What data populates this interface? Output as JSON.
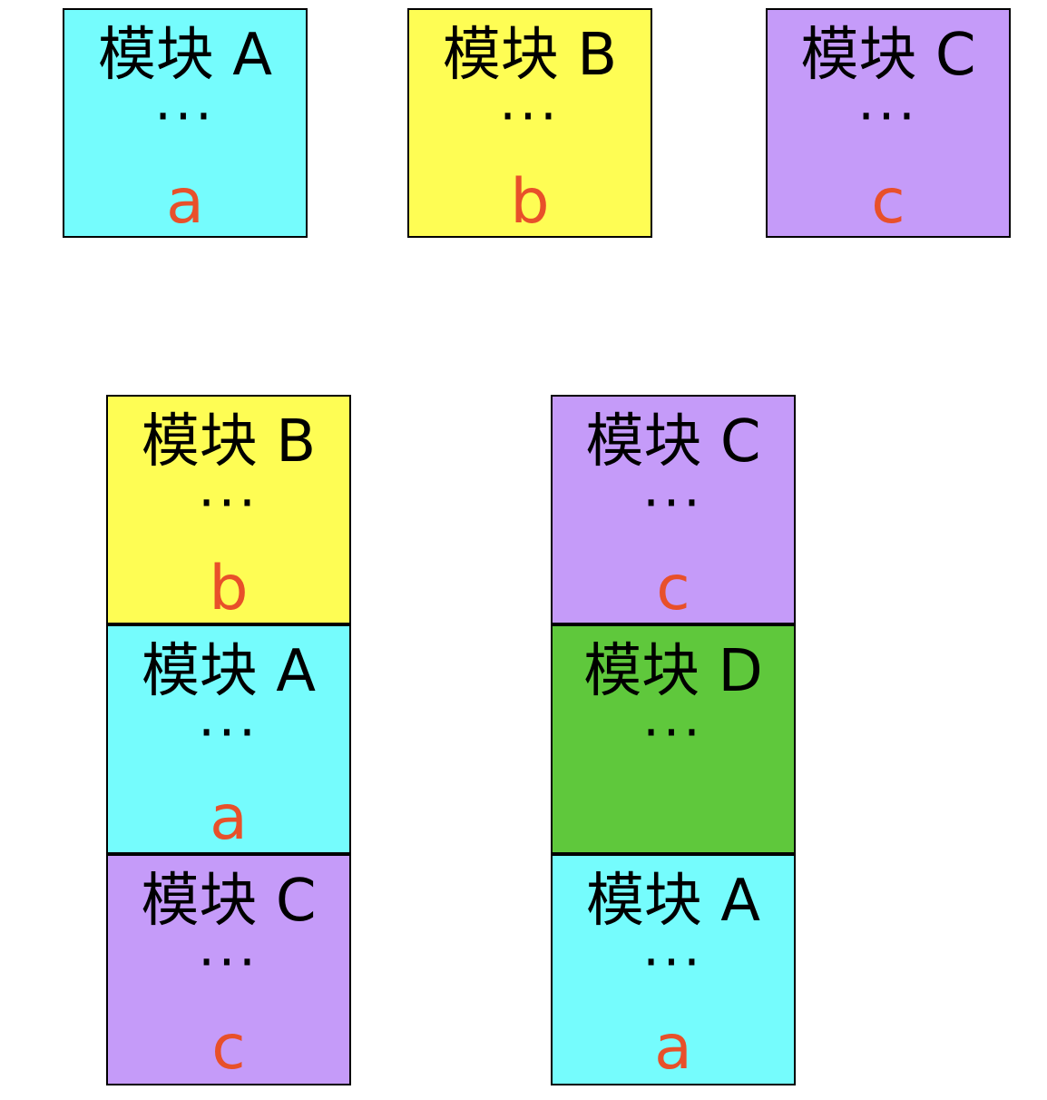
{
  "colors": {
    "A": "#75fcfd",
    "B": "#fefd54",
    "C": "#c59bf9",
    "D": "#5fc83c",
    "var_text": "#e8502a"
  },
  "top_row": [
    {
      "title": "模块 A",
      "dots": "···",
      "var": "a",
      "color_key": "A"
    },
    {
      "title": "模块 B",
      "dots": "···",
      "var": "b",
      "color_key": "B"
    },
    {
      "title": "模块 C",
      "dots": "···",
      "var": "c",
      "color_key": "C"
    }
  ],
  "left_stack": [
    {
      "title": "模块 B",
      "dots": "···",
      "var": "b",
      "color_key": "B"
    },
    {
      "title": "模块 A",
      "dots": "···",
      "var": "a",
      "color_key": "A"
    },
    {
      "title": "模块 C",
      "dots": "···",
      "var": "c",
      "color_key": "C"
    }
  ],
  "right_stack": [
    {
      "title": "模块 C",
      "dots": "···",
      "var": "c",
      "color_key": "C"
    },
    {
      "title": "模块 D",
      "dots": "···",
      "var": "",
      "color_key": "D"
    },
    {
      "title": "模块 A",
      "dots": "···",
      "var": "a",
      "color_key": "A"
    }
  ]
}
